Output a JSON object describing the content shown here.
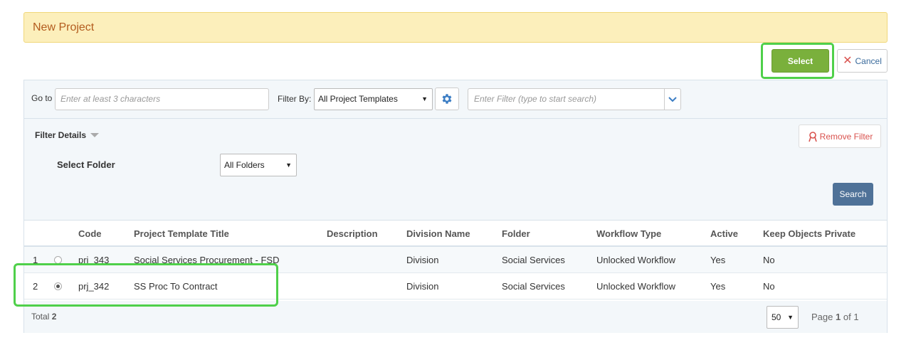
{
  "banner": {
    "title": "New Project"
  },
  "actions": {
    "select_label": "Select",
    "cancel_label": "Cancel"
  },
  "toolbar": {
    "goto_label": "Go to",
    "goto_placeholder": "Enter at least 3 characters",
    "filterby_label": "Filter By:",
    "filterby_value": "All Project Templates",
    "filter_placeholder": "Enter Filter (type to start search)"
  },
  "details": {
    "title": "Filter Details",
    "remove_filter_label": "Remove Filter",
    "folder_label": "Select Folder",
    "folder_value": "All Folders",
    "search_label": "Search"
  },
  "table": {
    "headers": {
      "code": "Code",
      "title": "Project Template Title",
      "description": "Description",
      "division": "Division Name",
      "folder": "Folder",
      "workflow": "Workflow Type",
      "active": "Active",
      "private": "Keep Objects Private"
    },
    "rows": [
      {
        "num": "1",
        "selected": false,
        "code": "prj_343",
        "title": "Social Services Procurement - FSD",
        "description": "",
        "division": "Division",
        "folder": "Social Services",
        "workflow": "Unlocked Workflow",
        "active": "Yes",
        "private": "No"
      },
      {
        "num": "2",
        "selected": true,
        "code": "prj_342",
        "title": "SS Proc To Contract",
        "description": "",
        "division": "Division",
        "folder": "Social Services",
        "workflow": "Unlocked Workflow",
        "active": "Yes",
        "private": "No"
      }
    ]
  },
  "footer": {
    "total_label": "Total",
    "total_value": "2",
    "page_size": "50",
    "page_prefix": "Page",
    "page_current": "1",
    "page_of": "of",
    "page_total": "1"
  },
  "colors": {
    "select_green": "#7ab03c",
    "highlight_green": "#4fd04a",
    "search_blue": "#4f7298",
    "banner_bg": "#fcefbb"
  }
}
